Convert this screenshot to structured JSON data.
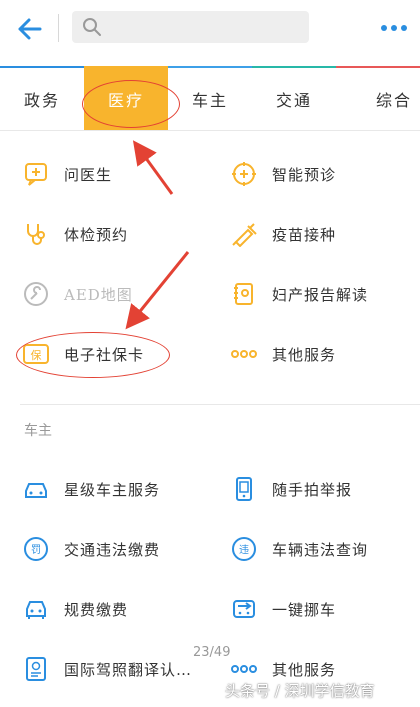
{
  "header": {
    "back_icon": "arrow-left-icon",
    "search_icon": "search-icon",
    "more_icon": "more-dots-icon",
    "accent": "#2a8ee0"
  },
  "tabs": [
    {
      "label": "政务",
      "active": false
    },
    {
      "label": "医疗",
      "active": true
    },
    {
      "label": "车主",
      "active": false
    },
    {
      "label": "交通",
      "active": false
    },
    {
      "label": "综合",
      "active": false
    }
  ],
  "medical": [
    {
      "label": "问医生",
      "icon": "chat-plus-icon"
    },
    {
      "label": "智能预诊",
      "icon": "target-plus-icon"
    },
    {
      "label": "体检预约",
      "icon": "stethoscope-icon"
    },
    {
      "label": "疫苗接种",
      "icon": "syringe-icon"
    },
    {
      "label": "AED地图",
      "icon": "wrench-icon",
      "disabled": true
    },
    {
      "label": "妇产报告解读",
      "icon": "notebook-icon"
    },
    {
      "label": "电子社保卡",
      "icon": "card-icon",
      "icon_text": "保"
    },
    {
      "label": "其他服务",
      "icon": "dots-icon"
    }
  ],
  "car_section": {
    "title": "车主",
    "items": [
      {
        "label": "星级车主服务",
        "icon": "car-icon"
      },
      {
        "label": "随手拍举报",
        "icon": "phone-icon"
      },
      {
        "label": "交通违法缴费",
        "icon": "fine-icon",
        "icon_text": "罚"
      },
      {
        "label": "车辆违法查询",
        "icon": "violation-icon",
        "icon_text": "违"
      },
      {
        "label": "规费缴费",
        "icon": "car-front-icon"
      },
      {
        "label": "一键挪车",
        "icon": "move-car-icon"
      },
      {
        "label": "国际驾照翻译认…",
        "icon": "license-icon"
      },
      {
        "label": "其他服务",
        "icon": "dots-icon"
      }
    ]
  },
  "page_indicator": "23/49",
  "watermark": "头条号 / 深圳学信教育",
  "colors": {
    "orange": "#f8b42d",
    "blue": "#2a8ee0",
    "red_annotation": "#e34234",
    "gray_disabled": "#bbbbbb"
  }
}
